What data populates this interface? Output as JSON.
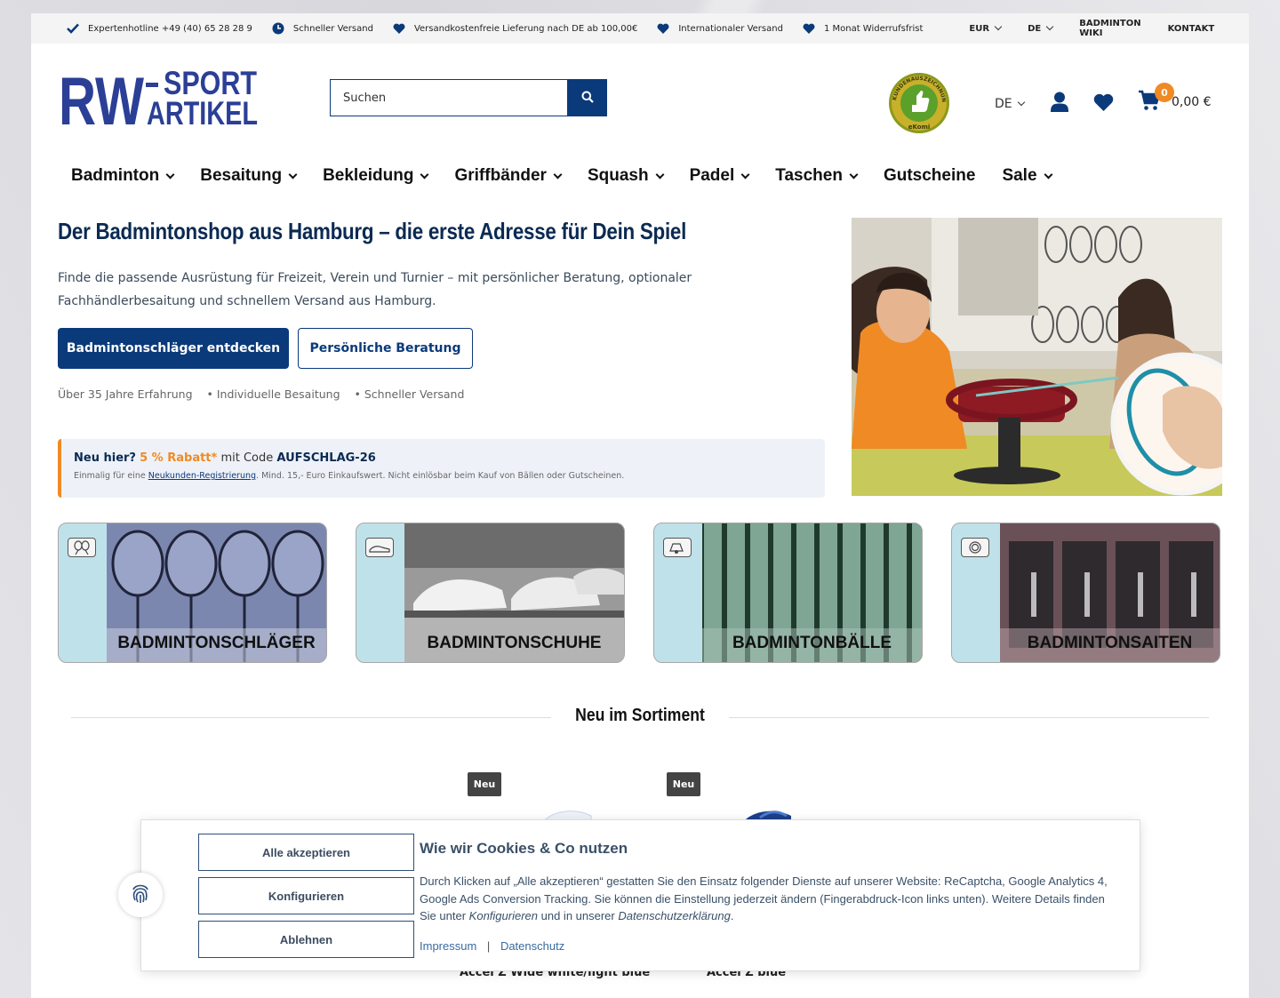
{
  "topbar": {
    "usps": [
      {
        "icon": "check-icon",
        "text": "Expertenhotline +49 (40) 65 28 28 9"
      },
      {
        "icon": "clock-icon",
        "text": "Schneller Versand"
      },
      {
        "icon": "heart-icon",
        "text": "Versandkostenfreie Lieferung nach DE ab 100,00€"
      },
      {
        "icon": "heart-icon",
        "text": "Internationaler Versand"
      },
      {
        "icon": "heart-icon",
        "text": "1 Monat Widerrufsfrist"
      }
    ],
    "currency": "EUR",
    "language": "DE",
    "wiki_link": "BADMINTON WIKI",
    "contact_link": "KONTAKT"
  },
  "header": {
    "logo_line1": "SPORT",
    "logo_line2": "ARTIKEL",
    "logo_mark": "RW",
    "search_placeholder": "Suchen",
    "ekomi_text": "KUNDENAUSZEICHNUNG",
    "ekomi_brand": "eKomi",
    "language": "DE",
    "cart_count": "0",
    "cart_total": "0,00 €"
  },
  "nav": {
    "items": [
      {
        "label": "Badminton",
        "has_dropdown": true
      },
      {
        "label": "Besaitung",
        "has_dropdown": true
      },
      {
        "label": "Bekleidung",
        "has_dropdown": true
      },
      {
        "label": "Griffbänder",
        "has_dropdown": true
      },
      {
        "label": "Squash",
        "has_dropdown": true
      },
      {
        "label": "Padel",
        "has_dropdown": true
      },
      {
        "label": "Taschen",
        "has_dropdown": true
      },
      {
        "label": "Gutscheine",
        "has_dropdown": false
      },
      {
        "label": "Sale",
        "has_dropdown": true
      }
    ]
  },
  "hero": {
    "title": "Der Badmintonshop aus Hamburg – die erste Adresse für Dein Spiel",
    "text": "Finde die passende Ausrüstung für Freizeit, Verein und Turnier – mit persönlicher Beratung, optionaler Fachhändlerbesaitung und schnellem Versand aus Hamburg.",
    "primary_button": "Badmintonschläger entdecken",
    "secondary_button": "Persönliche Beratung",
    "facts": [
      "Über 35 Jahre Erfahrung",
      "• Individuelle Besaitung",
      "• Schneller Versand"
    ]
  },
  "promo": {
    "new_here": "Neu hier?",
    "discount": "5 % Rabatt*",
    "with_code": "mit Code",
    "code": "AUFSCHLAG-26",
    "fine_print_pre": "Einmalig für eine",
    "fine_print_link": "Neukunden-Registrierung",
    "fine_print_post": ". Mind. 15,- Euro Einkaufswert. Nicht einlösbar beim Kauf von Bällen oder Gutscheinen."
  },
  "categories": [
    {
      "label": "BADMINTONSCHLÄGER",
      "icon": "racket-icon"
    },
    {
      "label": "BADMINTONSCHUHE",
      "icon": "shoe-icon"
    },
    {
      "label": "BADMINTONBÄLLE",
      "icon": "shuttlecock-icon"
    },
    {
      "label": "BADMINTONSAITEN",
      "icon": "string-coil-icon"
    }
  ],
  "new_products": {
    "title": "Neu im Sortiment",
    "badge": "Neu",
    "products": [
      {
        "name": "Accel Z Wide white/light blue"
      },
      {
        "name": "Accel Z blue"
      }
    ]
  },
  "cookie": {
    "accept_all": "Alle akzeptieren",
    "configure": "Konfigurieren",
    "decline": "Ablehnen",
    "title": "Wie wir Cookies & Co nutzen",
    "text_part1": "Durch Klicken auf „Alle akzeptieren“ gestatten Sie den Einsatz folgender Dienste auf unserer Website: ReCaptcha, Google Analytics 4, Google Ads Conversion Tracking. Sie können die Einstellung jederzeit ändern (Fingerabdruck-Icon links unten). Weitere Details finden Sie unter",
    "text_em1": "Konfigurieren",
    "text_part2": "und in unserer",
    "text_em2": "Datenschutzerklärung",
    "text_end": ".",
    "link_impressum": "Impressum",
    "link_separator": "|",
    "link_datenschutz": "Datenschutz"
  },
  "colors": {
    "brand_blue": "#0b3a7a",
    "accent_orange": "#f08a24",
    "category_tint": "#bfe2ea"
  }
}
